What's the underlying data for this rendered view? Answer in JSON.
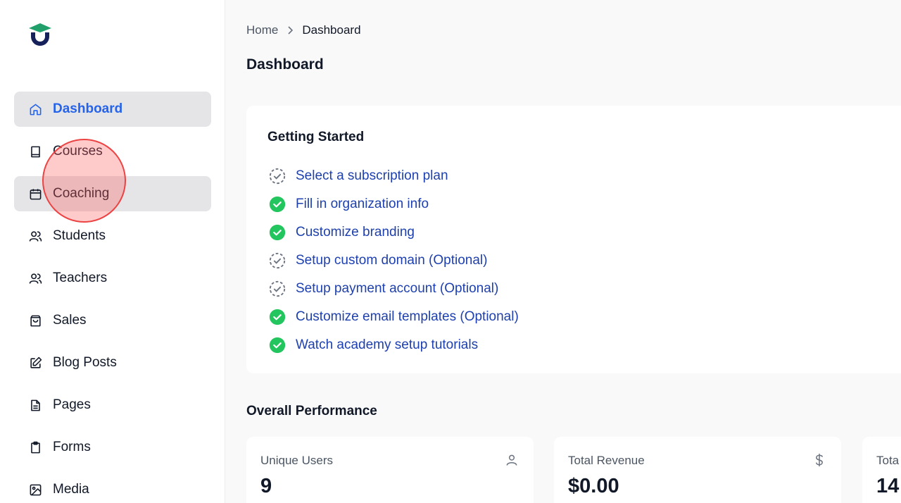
{
  "sidebar": {
    "logo_icon": "graduation-cap-logo",
    "items": [
      {
        "label": "Dashboard",
        "icon": "home-icon",
        "active": true
      },
      {
        "label": "Courses",
        "icon": "book-icon"
      },
      {
        "label": "Coaching",
        "icon": "calendar-icon",
        "hovered": true
      },
      {
        "label": "Students",
        "icon": "users-icon"
      },
      {
        "label": "Teachers",
        "icon": "users-icon"
      },
      {
        "label": "Sales",
        "icon": "shopping-bag-icon"
      },
      {
        "label": "Blog Posts",
        "icon": "edit-icon"
      },
      {
        "label": "Pages",
        "icon": "document-icon"
      },
      {
        "label": "Forms",
        "icon": "clipboard-icon"
      },
      {
        "label": "Media",
        "icon": "image-icon"
      }
    ]
  },
  "breadcrumb": {
    "home": "Home",
    "current": "Dashboard"
  },
  "page_title": "Dashboard",
  "getting_started": {
    "title": "Getting Started",
    "steps": [
      {
        "label": "Select a subscription plan",
        "done": false
      },
      {
        "label": "Fill in organization info",
        "done": true
      },
      {
        "label": "Customize branding",
        "done": true
      },
      {
        "label": "Setup custom domain (Optional)",
        "done": false
      },
      {
        "label": "Setup payment account (Optional)",
        "done": false
      },
      {
        "label": "Customize email templates (Optional)",
        "done": true
      },
      {
        "label": "Watch academy setup tutorials",
        "done": true
      }
    ]
  },
  "performance": {
    "title": "Overall Performance",
    "stats": [
      {
        "label": "Unique Users",
        "value": "9",
        "icon": "user-icon"
      },
      {
        "label": "Total Revenue",
        "value": "$0.00",
        "icon": "dollar-icon"
      },
      {
        "label": "Tota",
        "value": "14",
        "icon": ""
      }
    ]
  },
  "colors": {
    "accent": "#2563eb",
    "link": "#1e40af",
    "success": "#22c55e",
    "logo_green": "#22a06b",
    "logo_navy": "#16215a"
  }
}
